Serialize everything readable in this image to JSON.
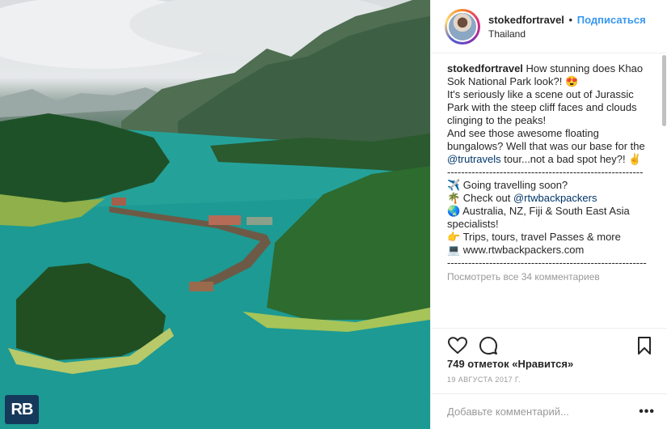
{
  "post": {
    "watermark": "RB",
    "header": {
      "username": "stokedfortravel",
      "separator": "•",
      "follow_label": "Подписаться",
      "location": "Thailand"
    },
    "caption": {
      "username": "stokedfortravel",
      "line1": " How stunning does Khao Sok National Park look?! 😍\nIt's seriously like a scene out of Jurassic Park with the steep cliff faces and clouds clinging to the peaks!\nAnd see those awesome floating bungalows? Well that was our base for the ",
      "mention1": "@trutravels",
      "line2": " tour...not a bad spot hey?! ✌️\n--------------------------------------------------------\n✈️ Going travelling soon?\n🌴 Check out ",
      "mention2": "@rtwbackpackers",
      "line3": "\n🌏 Australia, NZ, Fiji & South East Asia specialists!\n👉 Trips, tours, travel Passes & more\n💻 www.rtwbackpackers.com\n---------------------------------------------------------"
    },
    "view_all_comments": "Посмотреть все 34 комментариев",
    "icons": {
      "like": "heart-icon",
      "comment": "comment-icon",
      "save": "bookmark-icon",
      "options": "more-icon"
    },
    "likes_text": "749 отметок «Нравится»",
    "date": "19 АВГУСТА 2017 Г.",
    "comment_placeholder": "Добавьте комментарий...",
    "more_label": "•••"
  }
}
